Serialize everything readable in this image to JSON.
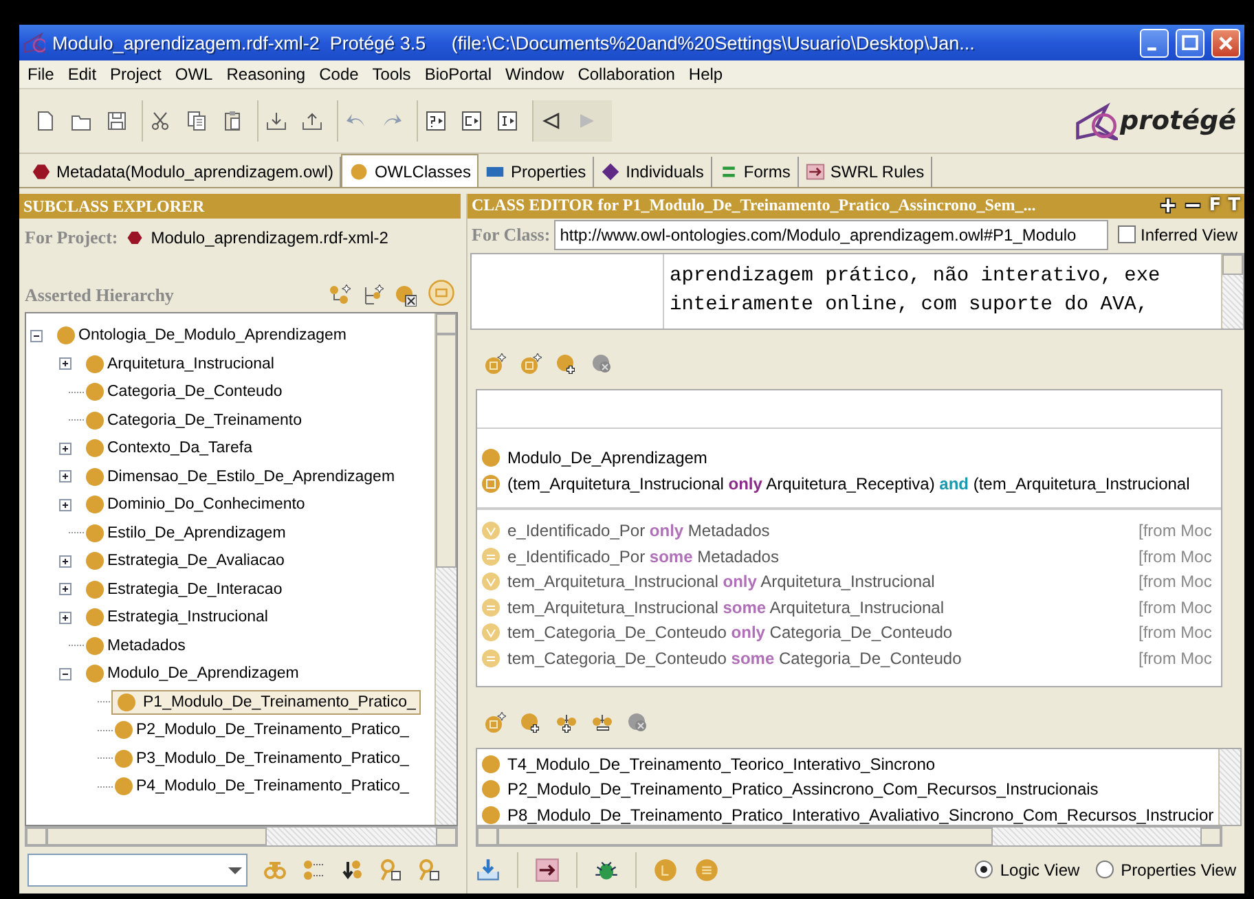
{
  "window": {
    "title": "Modulo_aprendizagem.rdf-xml-2  Protégé 3.5     (file:\\C:\\Documents%20and%20Settings\\Usuario\\Desktop\\Jan..."
  },
  "menu": [
    "File",
    "Edit",
    "Project",
    "OWL",
    "Reasoning",
    "Code",
    "Tools",
    "BioPortal",
    "Window",
    "Collaboration",
    "Help"
  ],
  "logo": "protégé",
  "tabs": [
    {
      "label": "Metadata(Modulo_aprendizagem.owl)",
      "kind": "metadata",
      "selected": false
    },
    {
      "label": "OWLClasses",
      "kind": "classes",
      "selected": true
    },
    {
      "label": "Properties",
      "kind": "properties",
      "selected": false
    },
    {
      "label": "Individuals",
      "kind": "individuals",
      "selected": false
    },
    {
      "label": "Forms",
      "kind": "forms",
      "selected": false
    },
    {
      "label": "SWRL Rules",
      "kind": "swrl",
      "selected": false
    }
  ],
  "subclass_explorer": {
    "title": "SUBCLASS EXPLORER",
    "project_label": "For Project:",
    "project": "Modulo_aprendizagem.rdf-xml-2",
    "hierarchy_label": "Asserted Hierarchy",
    "tree": [
      {
        "label": "Ontologia_De_Modulo_Aprendizagem",
        "expandable": true,
        "expanded": true,
        "selected": false,
        "children": [
          {
            "label": "Arquitetura_Instrucional",
            "expandable": true,
            "expanded": false,
            "selected": false
          },
          {
            "label": "Categoria_De_Conteudo",
            "expandable": false,
            "selected": false
          },
          {
            "label": "Categoria_De_Treinamento",
            "expandable": false,
            "selected": false
          },
          {
            "label": "Contexto_Da_Tarefa",
            "expandable": true,
            "expanded": false,
            "selected": false
          },
          {
            "label": "Dimensao_De_Estilo_De_Aprendizagem",
            "expandable": true,
            "expanded": false,
            "selected": false
          },
          {
            "label": "Dominio_Do_Conhecimento",
            "expandable": true,
            "expanded": false,
            "selected": false
          },
          {
            "label": "Estilo_De_Aprendizagem",
            "expandable": false,
            "selected": false
          },
          {
            "label": "Estrategia_De_Avaliacao",
            "expandable": true,
            "expanded": false,
            "selected": false
          },
          {
            "label": "Estrategia_De_Interacao",
            "expandable": true,
            "expanded": false,
            "selected": false
          },
          {
            "label": "Estrategia_Instrucional",
            "expandable": true,
            "expanded": false,
            "selected": false
          },
          {
            "label": "Metadados",
            "expandable": false,
            "selected": false
          },
          {
            "label": "Modulo_De_Aprendizagem",
            "expandable": true,
            "expanded": true,
            "selected": false,
            "children": [
              {
                "label": "P1_Modulo_De_Treinamento_Pratico_",
                "expandable": false,
                "selected": true
              },
              {
                "label": "P2_Modulo_De_Treinamento_Pratico_",
                "expandable": false,
                "selected": false
              },
              {
                "label": "P3_Modulo_De_Treinamento_Pratico_",
                "expandable": false,
                "selected": false
              },
              {
                "label": "P4_Modulo_De_Treinamento_Pratico_",
                "expandable": false,
                "selected": false
              }
            ]
          }
        ]
      }
    ]
  },
  "class_editor": {
    "title": "CLASS EDITOR for P1_Modulo_De_Treinamento_Pratico_Assincrono_Sem_...",
    "title_buttons": [
      "F",
      "T"
    ],
    "for_class_label": "For Class:",
    "uri": "http://www.owl-ontologies.com/Modulo_aprendizagem.owl#P1_Modulo",
    "inferred_view": {
      "label": "Inferred View",
      "checked": false
    },
    "annotation": [
      "aprendizagem prático, não interativo, exe",
      "inteiramente online, com suporte do AVA,"
    ],
    "superclasses": [
      {
        "kind": "named",
        "parts": [
          {
            "kind": "plain",
            "text": "Modulo_De_Aprendizagem"
          }
        ]
      },
      {
        "kind": "defined",
        "parts": [
          {
            "kind": "plain",
            "text": "(tem_Arquitetura_Instrucional "
          },
          {
            "kind": "quantifier",
            "text": "only"
          },
          {
            "kind": "plain",
            "text": " Arquitetura_Receptiva) "
          },
          {
            "kind": "operator",
            "text": "and"
          },
          {
            "kind": "plain",
            "text": " (tem_Arquitetura_Instrucional"
          }
        ]
      }
    ],
    "inherited": [
      {
        "kind": "all",
        "parts": [
          {
            "kind": "plain",
            "text": "e_Identificado_Por "
          },
          {
            "kind": "quantifier",
            "text": "only"
          },
          {
            "kind": "plain",
            "text": " Metadados"
          }
        ],
        "source": "[from Moc"
      },
      {
        "kind": "some",
        "parts": [
          {
            "kind": "plain",
            "text": "e_Identificado_Por "
          },
          {
            "kind": "quantifier",
            "text": "some"
          },
          {
            "kind": "plain",
            "text": " Metadados"
          }
        ],
        "source": "[from Moc"
      },
      {
        "kind": "all",
        "parts": [
          {
            "kind": "plain",
            "text": "tem_Arquitetura_Instrucional "
          },
          {
            "kind": "quantifier",
            "text": "only"
          },
          {
            "kind": "plain",
            "text": " Arquitetura_Instrucional"
          }
        ],
        "source": "[from Moc"
      },
      {
        "kind": "some",
        "parts": [
          {
            "kind": "plain",
            "text": "tem_Arquitetura_Instrucional "
          },
          {
            "kind": "quantifier",
            "text": "some"
          },
          {
            "kind": "plain",
            "text": " Arquitetura_Instrucional"
          }
        ],
        "source": "[from Moc"
      },
      {
        "kind": "all",
        "parts": [
          {
            "kind": "plain",
            "text": "tem_Categoria_De_Conteudo "
          },
          {
            "kind": "quantifier",
            "text": "only"
          },
          {
            "kind": "plain",
            "text": " Categoria_De_Conteudo"
          }
        ],
        "source": "[from Moc"
      },
      {
        "kind": "some",
        "parts": [
          {
            "kind": "plain",
            "text": "tem_Categoria_De_Conteudo "
          },
          {
            "kind": "quantifier",
            "text": "some"
          },
          {
            "kind": "plain",
            "text": " Categoria_De_Conteudo"
          }
        ],
        "source": "[from Moc"
      }
    ],
    "disjoints": [
      "T4_Modulo_De_Treinamento_Teorico_Interativo_Sincrono",
      "P2_Modulo_De_Treinamento_Pratico_Assincrono_Com_Recursos_Instrucionais",
      "P8_Modulo_De_Treinamento_Pratico_Interativo_Avaliativo_Sincrono_Com_Recursos_Instrucior"
    ],
    "views": [
      {
        "label": "Logic View",
        "selected": true
      },
      {
        "label": "Properties View",
        "selected": false
      }
    ]
  }
}
